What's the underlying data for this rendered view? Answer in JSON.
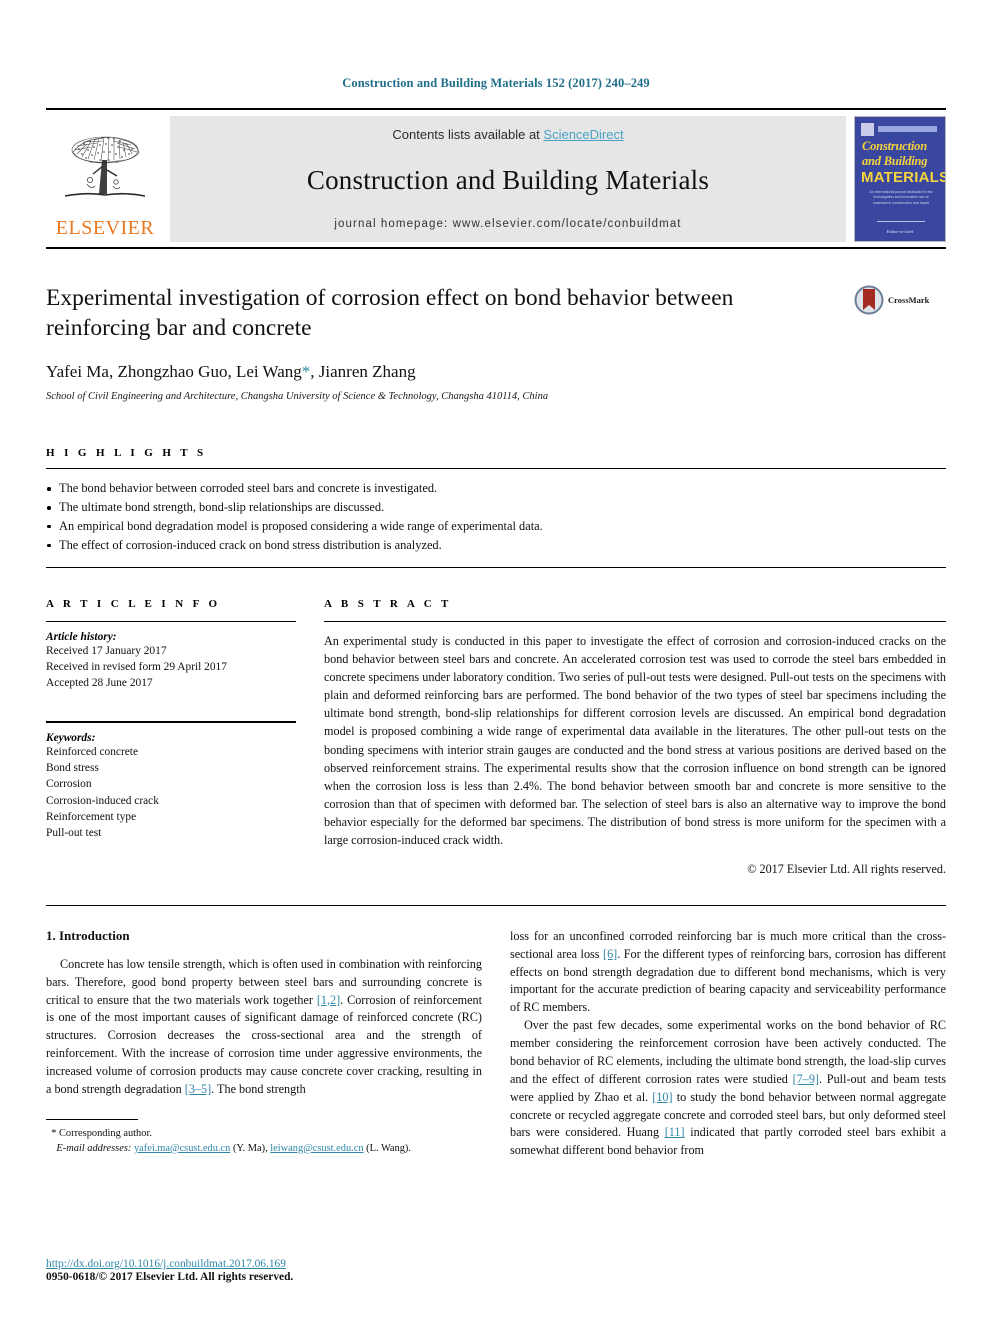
{
  "running_head": "Construction and Building Materials 152 (2017) 240–249",
  "masthead": {
    "elsevier_wordmark": "ELSEVIER",
    "contents_prefix": "Contents lists available at ",
    "sciencedirect_link": "ScienceDirect",
    "journal_name": "Construction and Building Materials",
    "homepage_label": "journal homepage: www.elsevier.com/locate/conbuildmat",
    "cover": {
      "line1": "Construction",
      "line2": "and Building",
      "line3": "MATERIALS",
      "blurb": "An international journal dedicated to the investigation and innovative use of materials in construction and repair",
      "footer": "Editor-in-chief"
    },
    "accent_link_color": "#4aa3c4",
    "elsevier_orange": "#e87722",
    "band_gray": "#e6e6e6"
  },
  "article": {
    "title": "Experimental investigation of corrosion effect on bond behavior between reinforcing bar and concrete",
    "authors_pre": "Yafei Ma, Zhongzhao Guo, Lei Wang",
    "authors_star": "*",
    "authors_post": ", Jianren Zhang",
    "affiliation": "School of Civil Engineering and Architecture, Changsha University of Science & Technology, Changsha 410114, China",
    "crossmark_label": "CrossMark"
  },
  "highlights": {
    "label": "H I G H L I G H T S",
    "items": [
      "The bond behavior between corroded steel bars and concrete is investigated.",
      "The ultimate bond strength, bond-slip relationships are discussed.",
      "An empirical bond degradation model is proposed considering a wide range of experimental data.",
      "The effect of corrosion-induced crack on bond stress distribution is analyzed."
    ]
  },
  "article_info": {
    "label": "A R T I C L E    I N F O",
    "history_head": "Article history:",
    "history": [
      "Received 17 January 2017",
      "Received in revised form 29 April 2017",
      "Accepted 28 June 2017"
    ],
    "keywords_head": "Keywords:",
    "keywords": [
      "Reinforced concrete",
      "Bond stress",
      "Corrosion",
      "Corrosion-induced crack",
      "Reinforcement type",
      "Pull-out test"
    ]
  },
  "abstract": {
    "label": "A B S T R A C T",
    "body": "An experimental study is conducted in this paper to investigate the effect of corrosion and corrosion-induced cracks on the bond behavior between steel bars and concrete. An accelerated corrosion test was used to corrode the steel bars embedded in concrete specimens under laboratory condition. Two series of pull-out tests were designed. Pull-out tests on the specimens with plain and deformed reinforcing bars are performed. The bond behavior of the two types of steel bar specimens including the ultimate bond strength, bond-slip relationships for different corrosion levels are discussed. An empirical bond degradation model is proposed combining a wide range of experimental data available in the literatures. The other pull-out tests on the bonding specimens with interior strain gauges are conducted and the bond stress at various positions are derived based on the observed reinforcement strains. The experimental results show that the corrosion influence on bond strength can be ignored when the corrosion loss is less than 2.4%. The bond behavior between smooth bar and concrete is more sensitive to the corrosion than that of specimen with deformed bar. The selection of steel bars is also an alternative way to improve the bond behavior especially for the deformed bar specimens. The distribution of bond stress is more uniform for the specimen with a large corrosion-induced crack width.",
    "copyright": "© 2017 Elsevier Ltd. All rights reserved."
  },
  "body": {
    "section_heading": "1. Introduction",
    "left_paragraph_1_a": "Concrete has low tensile strength, which is often used in combination with reinforcing bars. Therefore, good bond property between steel bars and surrounding concrete is critical to ensure that the two materials work together ",
    "left_ref_1": "[1,2]",
    "left_paragraph_1_b": ". Corrosion of reinforcement is one of the most important causes of significant damage of reinforced concrete (RC) structures. Corrosion decreases the cross-sectional area and the strength of reinforcement. With the increase of corrosion time under aggressive environments, the increased volume of corrosion products may cause concrete cover cracking, resulting in a bond strength degradation ",
    "left_ref_2": "[3–5]",
    "left_paragraph_1_c": ". The bond strength",
    "right_paragraph_1_a": "loss for an unconfined corroded reinforcing bar is much more critical than the cross-sectional area loss ",
    "right_ref_1": "[6]",
    "right_paragraph_1_b": ". For the different types of reinforcing bars, corrosion has different effects on bond strength degradation due to different bond mechanisms, which is very important for the accurate prediction of bearing capacity and serviceability performance of RC members.",
    "right_paragraph_2_a": "Over the past few decades, some experimental works on the bond behavior of RC member considering the reinforcement corrosion have been actively conducted. The bond behavior of RC elements, including the ultimate bond strength, the load-slip curves and the effect of different corrosion rates were studied ",
    "right_ref_2": "[7–9]",
    "right_paragraph_2_b": ". Pull-out and beam tests were applied by Zhao et al. ",
    "right_ref_3": "[10]",
    "right_paragraph_2_c": " to study the bond behavior between normal aggregate concrete or recycled aggregate concrete and corroded steel bars, but only deformed steel bars were considered. Huang ",
    "right_ref_4": "[11]",
    "right_paragraph_2_d": " indicated that partly corroded steel bars exhibit a somewhat different bond behavior from"
  },
  "footnote": {
    "star": "*",
    "corresponding": " Corresponding author.",
    "email_label": "E-mail addresses:",
    "email1": "yafei.ma@csust.edu.cn",
    "email1_owner": " (Y. Ma), ",
    "email2": "leiwang@csust.edu.cn",
    "email2_owner": " (L. Wang)."
  },
  "page_footer": {
    "doi": "http://dx.doi.org/10.1016/j.conbuildmat.2017.06.169",
    "issn": "0950-0618/© 2017 Elsevier Ltd. All rights reserved."
  }
}
